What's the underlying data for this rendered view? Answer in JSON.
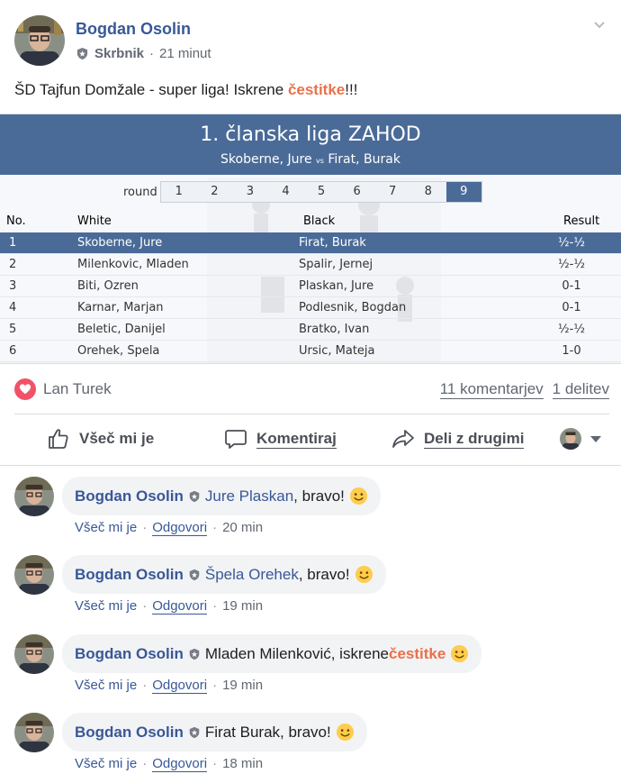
{
  "post": {
    "author": "Bogdan Osolin",
    "role": "Skrbnik",
    "time": "21 minut",
    "text_before": "ŠD Tajfun Domžale - super liga! Iskrene ",
    "text_highlight": "čestitke",
    "text_after": "!!!"
  },
  "league": {
    "title": "1. članska liga ZAHOD",
    "sub_white": "Skoberne, Jure",
    "sub_vs": "vs",
    "sub_black": "Firat, Burak",
    "round_label": "round",
    "rounds": [
      "1",
      "2",
      "3",
      "4",
      "5",
      "6",
      "7",
      "8",
      "9"
    ],
    "active_round": "9",
    "headers": {
      "no": "No.",
      "white": "White",
      "black": "Black",
      "result": "Result"
    },
    "rows": [
      {
        "no": "1",
        "white": "Skoberne, Jure",
        "black": "Firat, Burak",
        "result": "½-½"
      },
      {
        "no": "2",
        "white": "Milenkovic, Mladen",
        "black": "Spalir, Jernej",
        "result": "½-½"
      },
      {
        "no": "3",
        "white": "Biti, Ozren",
        "black": "Plaskan, Jure",
        "result": "0-1"
      },
      {
        "no": "4",
        "white": "Karnar, Marjan",
        "black": "Podlesnik, Bogdan",
        "result": "0-1"
      },
      {
        "no": "5",
        "white": "Beletic, Danijel",
        "black": "Bratko, Ivan",
        "result": "½-½"
      },
      {
        "no": "6",
        "white": "Orehek, Spela",
        "black": "Ursic, Mateja",
        "result": "1-0"
      }
    ]
  },
  "reactions": {
    "names": "Lan Turek",
    "comments": "11 komentarjev",
    "shares": "1 delitev"
  },
  "actions": {
    "like": "Všeč mi je",
    "comment": "Komentiraj",
    "share": "Deli z drugimi"
  },
  "comments": [
    {
      "author": "Bogdan Osolin",
      "mention": "Jure Plaskan",
      "text": ", bravo!",
      "highlight": "",
      "time": "20 min"
    },
    {
      "author": "Bogdan Osolin",
      "mention": "Špela Orehek",
      "text": ", bravo!",
      "highlight": "",
      "time": "19 min"
    },
    {
      "author": "Bogdan Osolin",
      "mention": "",
      "text": "Mladen Milenković, iskrene ",
      "highlight": "čestitke",
      "time": "19 min"
    },
    {
      "author": "Bogdan Osolin",
      "mention": "",
      "text": "Firat Burak, bravo!",
      "highlight": "",
      "time": "18 min"
    }
  ],
  "comment_actions": {
    "like": "Všeč mi je",
    "reply": "Odgovori",
    "sep": "·"
  },
  "colors": {
    "link": "#385898",
    "accent": "#e9714b",
    "league_blue": "#4a6b98",
    "heart": "#f25268"
  }
}
